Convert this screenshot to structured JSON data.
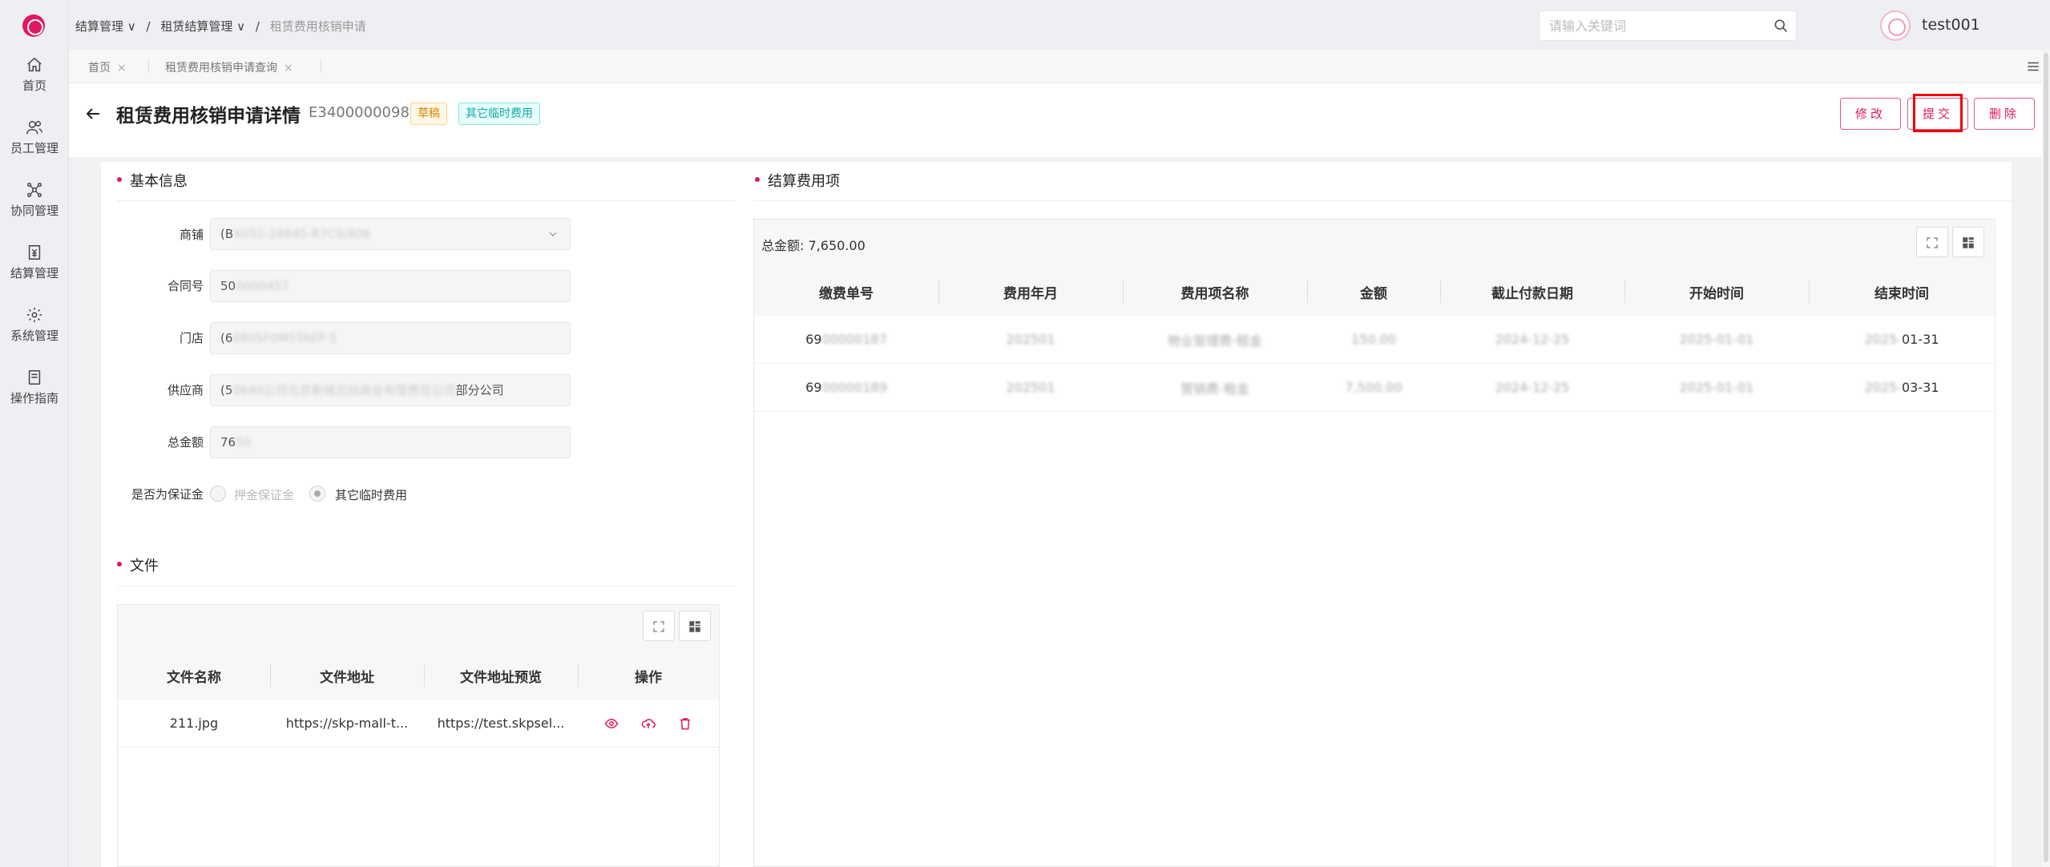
{
  "sidebar": {
    "items": [
      {
        "label": "首页",
        "icon": "home-icon"
      },
      {
        "label": "员工管理",
        "icon": "users-icon"
      },
      {
        "label": "协同管理",
        "icon": "network-icon"
      },
      {
        "label": "结算管理",
        "icon": "settlement-icon"
      },
      {
        "label": "系统管理",
        "icon": "gear-icon"
      },
      {
        "label": "操作指南",
        "icon": "book-icon"
      }
    ]
  },
  "header": {
    "breadcrumb": [
      "结算管理 ∨",
      "/",
      "租赁结算管理 ∨",
      "/",
      "租赁费用核销申请"
    ],
    "search_placeholder": "请输入关键词",
    "username": "test001"
  },
  "tabs": [
    {
      "label": "首页"
    },
    {
      "label": "租赁费用核销申请查询"
    }
  ],
  "page": {
    "title": "租赁费用核销申请详情",
    "code": "E3400000098",
    "tags": [
      "草稿",
      "其它临时费用"
    ],
    "buttons": {
      "edit": "修改",
      "submit": "提交",
      "delete": "删除"
    }
  },
  "basic_info": {
    "title": "基本信息",
    "fields": [
      {
        "label": "商铺",
        "value_prefix": "(B",
        "value_blur": "X052-28845-R7C9/806"
      },
      {
        "label": "合同号",
        "value_prefix": "50",
        "value_blur": "0000457"
      },
      {
        "label": "门店",
        "value_prefix": "(6",
        "value_blur": "0805F0M5TAEP-5"
      },
      {
        "label": "供应商",
        "value_prefix": "(5",
        "value_blur": "0640公司北京新城北站商业有限责任公司",
        "value_suffix": "部分公司"
      },
      {
        "label": "总金额",
        "value_prefix": "76",
        "value_blur": "50"
      }
    ],
    "deposit": {
      "label": "是否为保证金",
      "options": [
        {
          "label": "押金保证金",
          "checked": false
        },
        {
          "label": "其它临时费用",
          "checked": true
        }
      ]
    }
  },
  "files": {
    "title": "文件",
    "columns": [
      "文件名称",
      "文件地址",
      "文件地址预览",
      "操作"
    ],
    "rows": [
      {
        "name": "211.jpg",
        "url": "https://skp-mall-t...",
        "preview": "https://test.skpsel..."
      }
    ]
  },
  "fees": {
    "title": "结算费用项",
    "total_label": "总金额:",
    "total": "7,650.00",
    "columns": [
      "缴费单号",
      "费用年月",
      "费用项名称",
      "金额",
      "截止付款日期",
      "开始时间",
      "结束时间"
    ],
    "rows": [
      {
        "bill_prefix": "69",
        "bill_blur": "00000187",
        "month": "202501",
        "item": "物业管理费-租金",
        "amount": "150.00",
        "due": "2024-12-25",
        "start": "2025-01-01",
        "end_blur": "2025-",
        "end_suffix": "01-31"
      },
      {
        "bill_prefix": "69",
        "bill_blur": "00000189",
        "month": "202501",
        "item": "营销费-租金",
        "amount": "7,500.00",
        "due": "2024-12-25",
        "start": "2025-01-01",
        "end_blur": "2025-",
        "end_suffix": "03-31"
      }
    ]
  },
  "colors": {
    "accent": "#e0195f",
    "highlight": "#ee0000"
  }
}
